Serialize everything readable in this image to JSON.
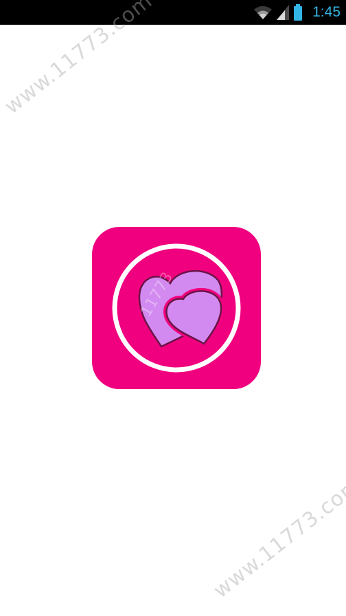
{
  "status_bar": {
    "time": "1:45",
    "icons": [
      "wifi-icon",
      "signal-icon",
      "battery-icon"
    ],
    "time_color": "#33b5e5",
    "background": "#000000"
  },
  "app_icon": {
    "icon": "two-hearts-icon",
    "background_color": "#f0007f",
    "ring_color": "#ffffff",
    "heart_color": "#d38af0",
    "heart_outline": "#6b1448"
  },
  "watermarks": {
    "top": "www.11773.com",
    "bottom": "www.11773.com",
    "icon": "11773"
  }
}
